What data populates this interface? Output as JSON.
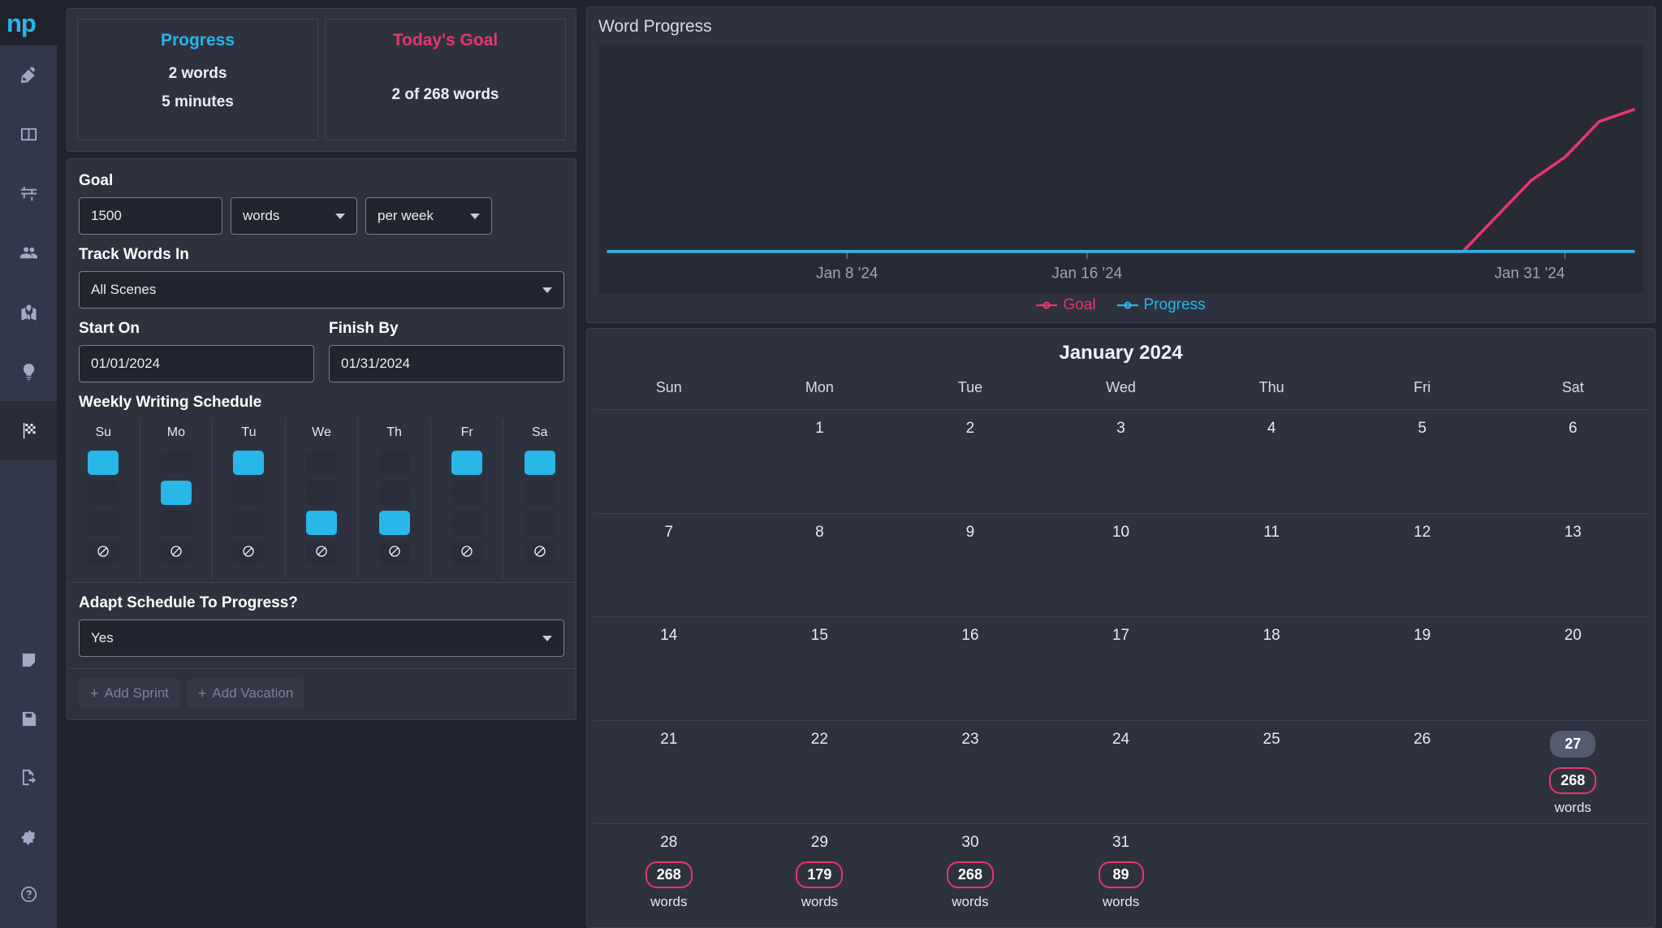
{
  "brand": {
    "logo": "np"
  },
  "sidebar": {
    "items": [
      {
        "name": "pen-icon",
        "label": "Write"
      },
      {
        "name": "book-columns-icon",
        "label": "Manuscript"
      },
      {
        "name": "outline-icon",
        "label": "Outline"
      },
      {
        "name": "people-icon",
        "label": "Characters"
      },
      {
        "name": "map-icon",
        "label": "Places"
      },
      {
        "name": "lightbulb-icon",
        "label": "Ideas"
      },
      {
        "name": "flag-checkered-icon",
        "label": "Goals"
      }
    ],
    "bottom_items": [
      {
        "name": "note-icon",
        "label": "Notes"
      },
      {
        "name": "save-icon",
        "label": "Save"
      },
      {
        "name": "export-icon",
        "label": "Export"
      },
      {
        "name": "gear-icon",
        "label": "Settings"
      },
      {
        "name": "help-icon",
        "label": "Help"
      }
    ],
    "active_index": 6
  },
  "summary": {
    "progress": {
      "title": "Progress",
      "words": "2 words",
      "minutes": "5 minutes",
      "color": "#29b6e8"
    },
    "todays_goal": {
      "title": "Today's Goal",
      "value": "2 of 268 words",
      "color": "#e8356d"
    }
  },
  "goal_form": {
    "goal_label": "Goal",
    "goal_amount": "1500",
    "goal_unit": "words",
    "goal_period": "per week",
    "track_label": "Track Words In",
    "track_value": "All Scenes",
    "start_label": "Start On",
    "start_value": "01/01/2024",
    "finish_label": "Finish By",
    "finish_value": "01/31/2024",
    "schedule_label": "Weekly Writing Schedule",
    "adapt_label": "Adapt Schedule To Progress?",
    "adapt_value": "Yes",
    "add_sprint": "Add Sprint",
    "add_vacation": "Add Vacation"
  },
  "schedule": {
    "days": [
      "Su",
      "Mo",
      "Tu",
      "We",
      "Th",
      "Fr",
      "Sa"
    ],
    "levels": [
      "high",
      "medium",
      "low",
      "off"
    ],
    "selected": [
      "high",
      "medium",
      "high",
      "low",
      "low",
      "high",
      "high"
    ]
  },
  "chart_data": {
    "type": "line",
    "title": "Word Progress",
    "xlabel": "",
    "ylabel": "",
    "x_ticks": [
      "Jan 8 '24",
      "Jan 16 '24",
      "Jan 31 '24"
    ],
    "x_tick_positions": [
      0.233,
      0.467,
      0.933
    ],
    "xlim": [
      "Jan 1 '24",
      "Jan 31 '24"
    ],
    "ylim": [
      0,
      1500
    ],
    "grid": false,
    "legend_position": "bottom-center",
    "series": [
      {
        "name": "Goal",
        "color": "#e8356d",
        "x": [
          "Jan 1",
          "Jan 8",
          "Jan 16",
          "Jan 24",
          "Jan 26",
          "Jan 27",
          "Jan 28",
          "Jan 29",
          "Jan 30",
          "Jan 31"
        ],
        "values": [
          0,
          0,
          0,
          0,
          0,
          268,
          536,
          715,
          983,
          1072
        ]
      },
      {
        "name": "Progress",
        "color": "#29b6e8",
        "x": [
          "Jan 1",
          "Jan 8",
          "Jan 16",
          "Jan 24",
          "Jan 31"
        ],
        "values": [
          2,
          2,
          2,
          2,
          2
        ]
      }
    ]
  },
  "calendar": {
    "title": "January 2024",
    "weekdays": [
      "Sun",
      "Mon",
      "Tue",
      "Wed",
      "Thu",
      "Fri",
      "Sat"
    ],
    "weeks": [
      [
        {
          "day": ""
        },
        {
          "day": "1"
        },
        {
          "day": "2"
        },
        {
          "day": "3"
        },
        {
          "day": "4"
        },
        {
          "day": "5"
        },
        {
          "day": "6"
        }
      ],
      [
        {
          "day": "7"
        },
        {
          "day": "8"
        },
        {
          "day": "9"
        },
        {
          "day": "10"
        },
        {
          "day": "11"
        },
        {
          "day": "12"
        },
        {
          "day": "13"
        }
      ],
      [
        {
          "day": "14"
        },
        {
          "day": "15"
        },
        {
          "day": "16"
        },
        {
          "day": "17"
        },
        {
          "day": "18"
        },
        {
          "day": "19"
        },
        {
          "day": "20"
        }
      ],
      [
        {
          "day": "21"
        },
        {
          "day": "22"
        },
        {
          "day": "23"
        },
        {
          "day": "24"
        },
        {
          "day": "25"
        },
        {
          "day": "26"
        },
        {
          "day": "27",
          "badge_top": "27",
          "badge_top_style": "gray",
          "badge": "268",
          "badge_style": "pink",
          "badge_sub": "words"
        }
      ],
      [
        {
          "day": "28",
          "badge": "268",
          "badge_style": "pink",
          "badge_sub": "words"
        },
        {
          "day": "29",
          "badge": "179",
          "badge_style": "pink",
          "badge_sub": "words"
        },
        {
          "day": "30",
          "badge": "268",
          "badge_style": "pink",
          "badge_sub": "words"
        },
        {
          "day": "31",
          "badge": "89",
          "badge_style": "pink",
          "badge_sub": "words"
        },
        {
          "day": ""
        },
        {
          "day": ""
        },
        {
          "day": ""
        }
      ]
    ]
  },
  "colors": {
    "accent_cyan": "#29b6e8",
    "accent_pink": "#e8356d",
    "bg": "#21242e",
    "card": "#2e323f",
    "sidebar": "#33374a"
  }
}
